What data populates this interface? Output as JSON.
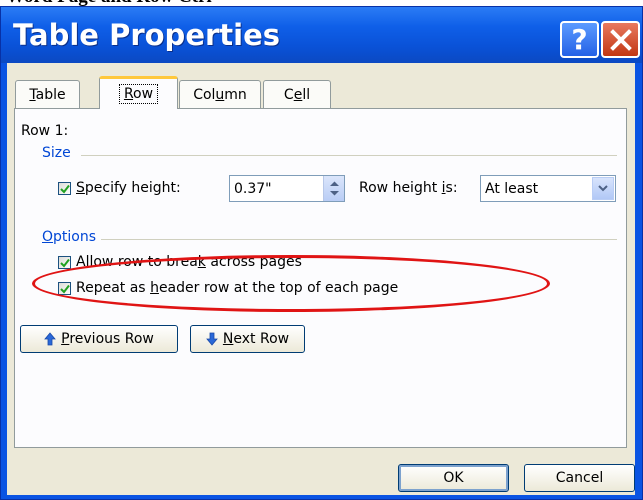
{
  "page_caption": "Word Page and Row Ctrl",
  "window": {
    "title": "Table Properties",
    "help_label": "?",
    "help_icon": "question-icon",
    "close_icon": "close-icon"
  },
  "tabs": [
    {
      "name": "Table",
      "ul": "T",
      "rest": "able",
      "active": false
    },
    {
      "name": "Row",
      "ul": "R",
      "rest": "ow",
      "active": true
    },
    {
      "name": "Column",
      "pre": "Col",
      "ul": "u",
      "rest": "mn",
      "active": false
    },
    {
      "name": "Cell",
      "pre": "C",
      "ul": "e",
      "rest": "ll",
      "active": false
    }
  ],
  "row_panel": {
    "row_label": "Row 1:",
    "size_group": "Size",
    "specify_height": {
      "pre": "",
      "ul": "S",
      "rest": "pecify height:",
      "checked": true
    },
    "height_value": "0.37\"",
    "row_height_is": {
      "pre": "Row height ",
      "ul": "i",
      "rest": "s:"
    },
    "row_height_mode": "At least",
    "options_group": {
      "pre": "",
      "ul": "O",
      "rest": "ptions"
    },
    "allow_break": {
      "pre": "Allow row to brea",
      "ul": "k",
      "rest": " across pages",
      "checked": true
    },
    "repeat_header": {
      "pre": "Repeat as ",
      "ul": "h",
      "rest": "eader row at the top of each page",
      "checked": true
    },
    "prev_row": {
      "pre": "",
      "ul": "P",
      "rest": "revious Row",
      "icon": "arrow-up-icon"
    },
    "next_row": {
      "pre": "",
      "ul": "N",
      "rest": "ext Row",
      "icon": "arrow-down-icon"
    }
  },
  "footer": {
    "ok_label": "OK",
    "cancel_label": "Cancel"
  },
  "colors": {
    "title_bar": "#0a54e3",
    "group_title": "#0046d5",
    "annotation": "#e01414",
    "tab_highlight": "#ffc83c"
  }
}
